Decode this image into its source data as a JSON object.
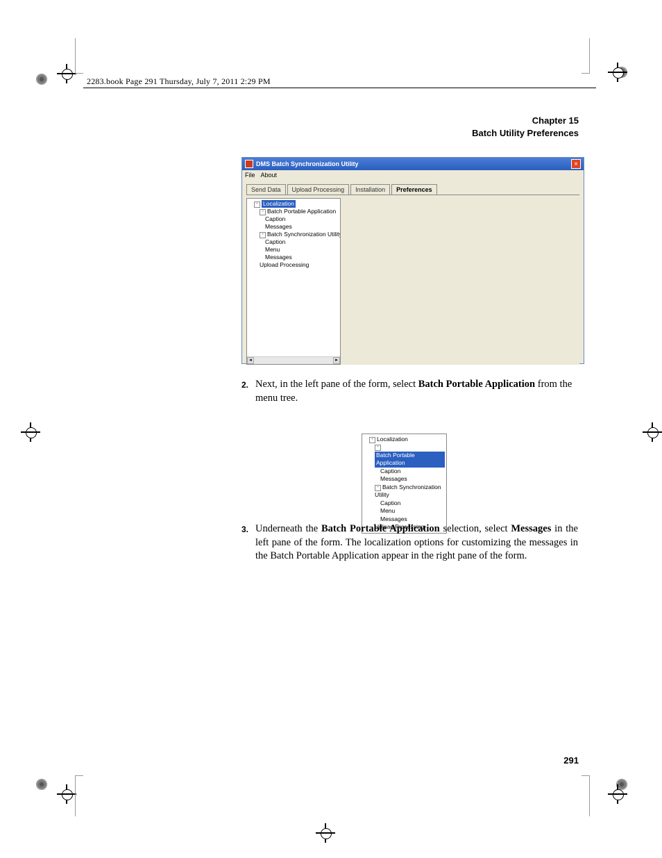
{
  "header": {
    "line": "2283.book  Page 291  Thursday, July 7, 2011  2:29 PM"
  },
  "page_header": {
    "chapter": "Chapter 15",
    "title": "Batch Utility Preferences"
  },
  "page_number": "291",
  "win": {
    "title": "DMS Batch Synchronization Utility",
    "menu": [
      "File",
      "About"
    ],
    "tabs": [
      "Send Data",
      "Upload Processing",
      "Installation",
      "Preferences"
    ],
    "tree": {
      "root": "Localization",
      "n1": "Batch Portable Application",
      "n1a": "Caption",
      "n1b": "Messages",
      "n2": "Batch Synchronization Utility",
      "n2a": "Caption",
      "n2b": "Menu",
      "n2c": "Messages",
      "n3": "Upload Processing"
    }
  },
  "step2": {
    "num": "2.",
    "t1": "Next, in the left pane of the form, select ",
    "b1": "Batch Portable Application",
    "t2": " from the menu tree."
  },
  "mini": {
    "root": "Localization",
    "sel": "Batch Portable Application",
    "a": "Caption",
    "b": "Messages",
    "n2": "Batch Synchronization Utility",
    "n2a": "Caption",
    "n2b": "Menu",
    "n2c": "Messages",
    "n3": "Upload Processing"
  },
  "step3": {
    "num": "3.",
    "t1": "Underneath the ",
    "b1": "Batch Portable Application",
    "t2": " selection, select ",
    "b2": "Mes­sages",
    "t3": " in the left pane of the form. The localization options for custom­izing the messages in the Batch Portable Application appear in the right pane of the form."
  }
}
